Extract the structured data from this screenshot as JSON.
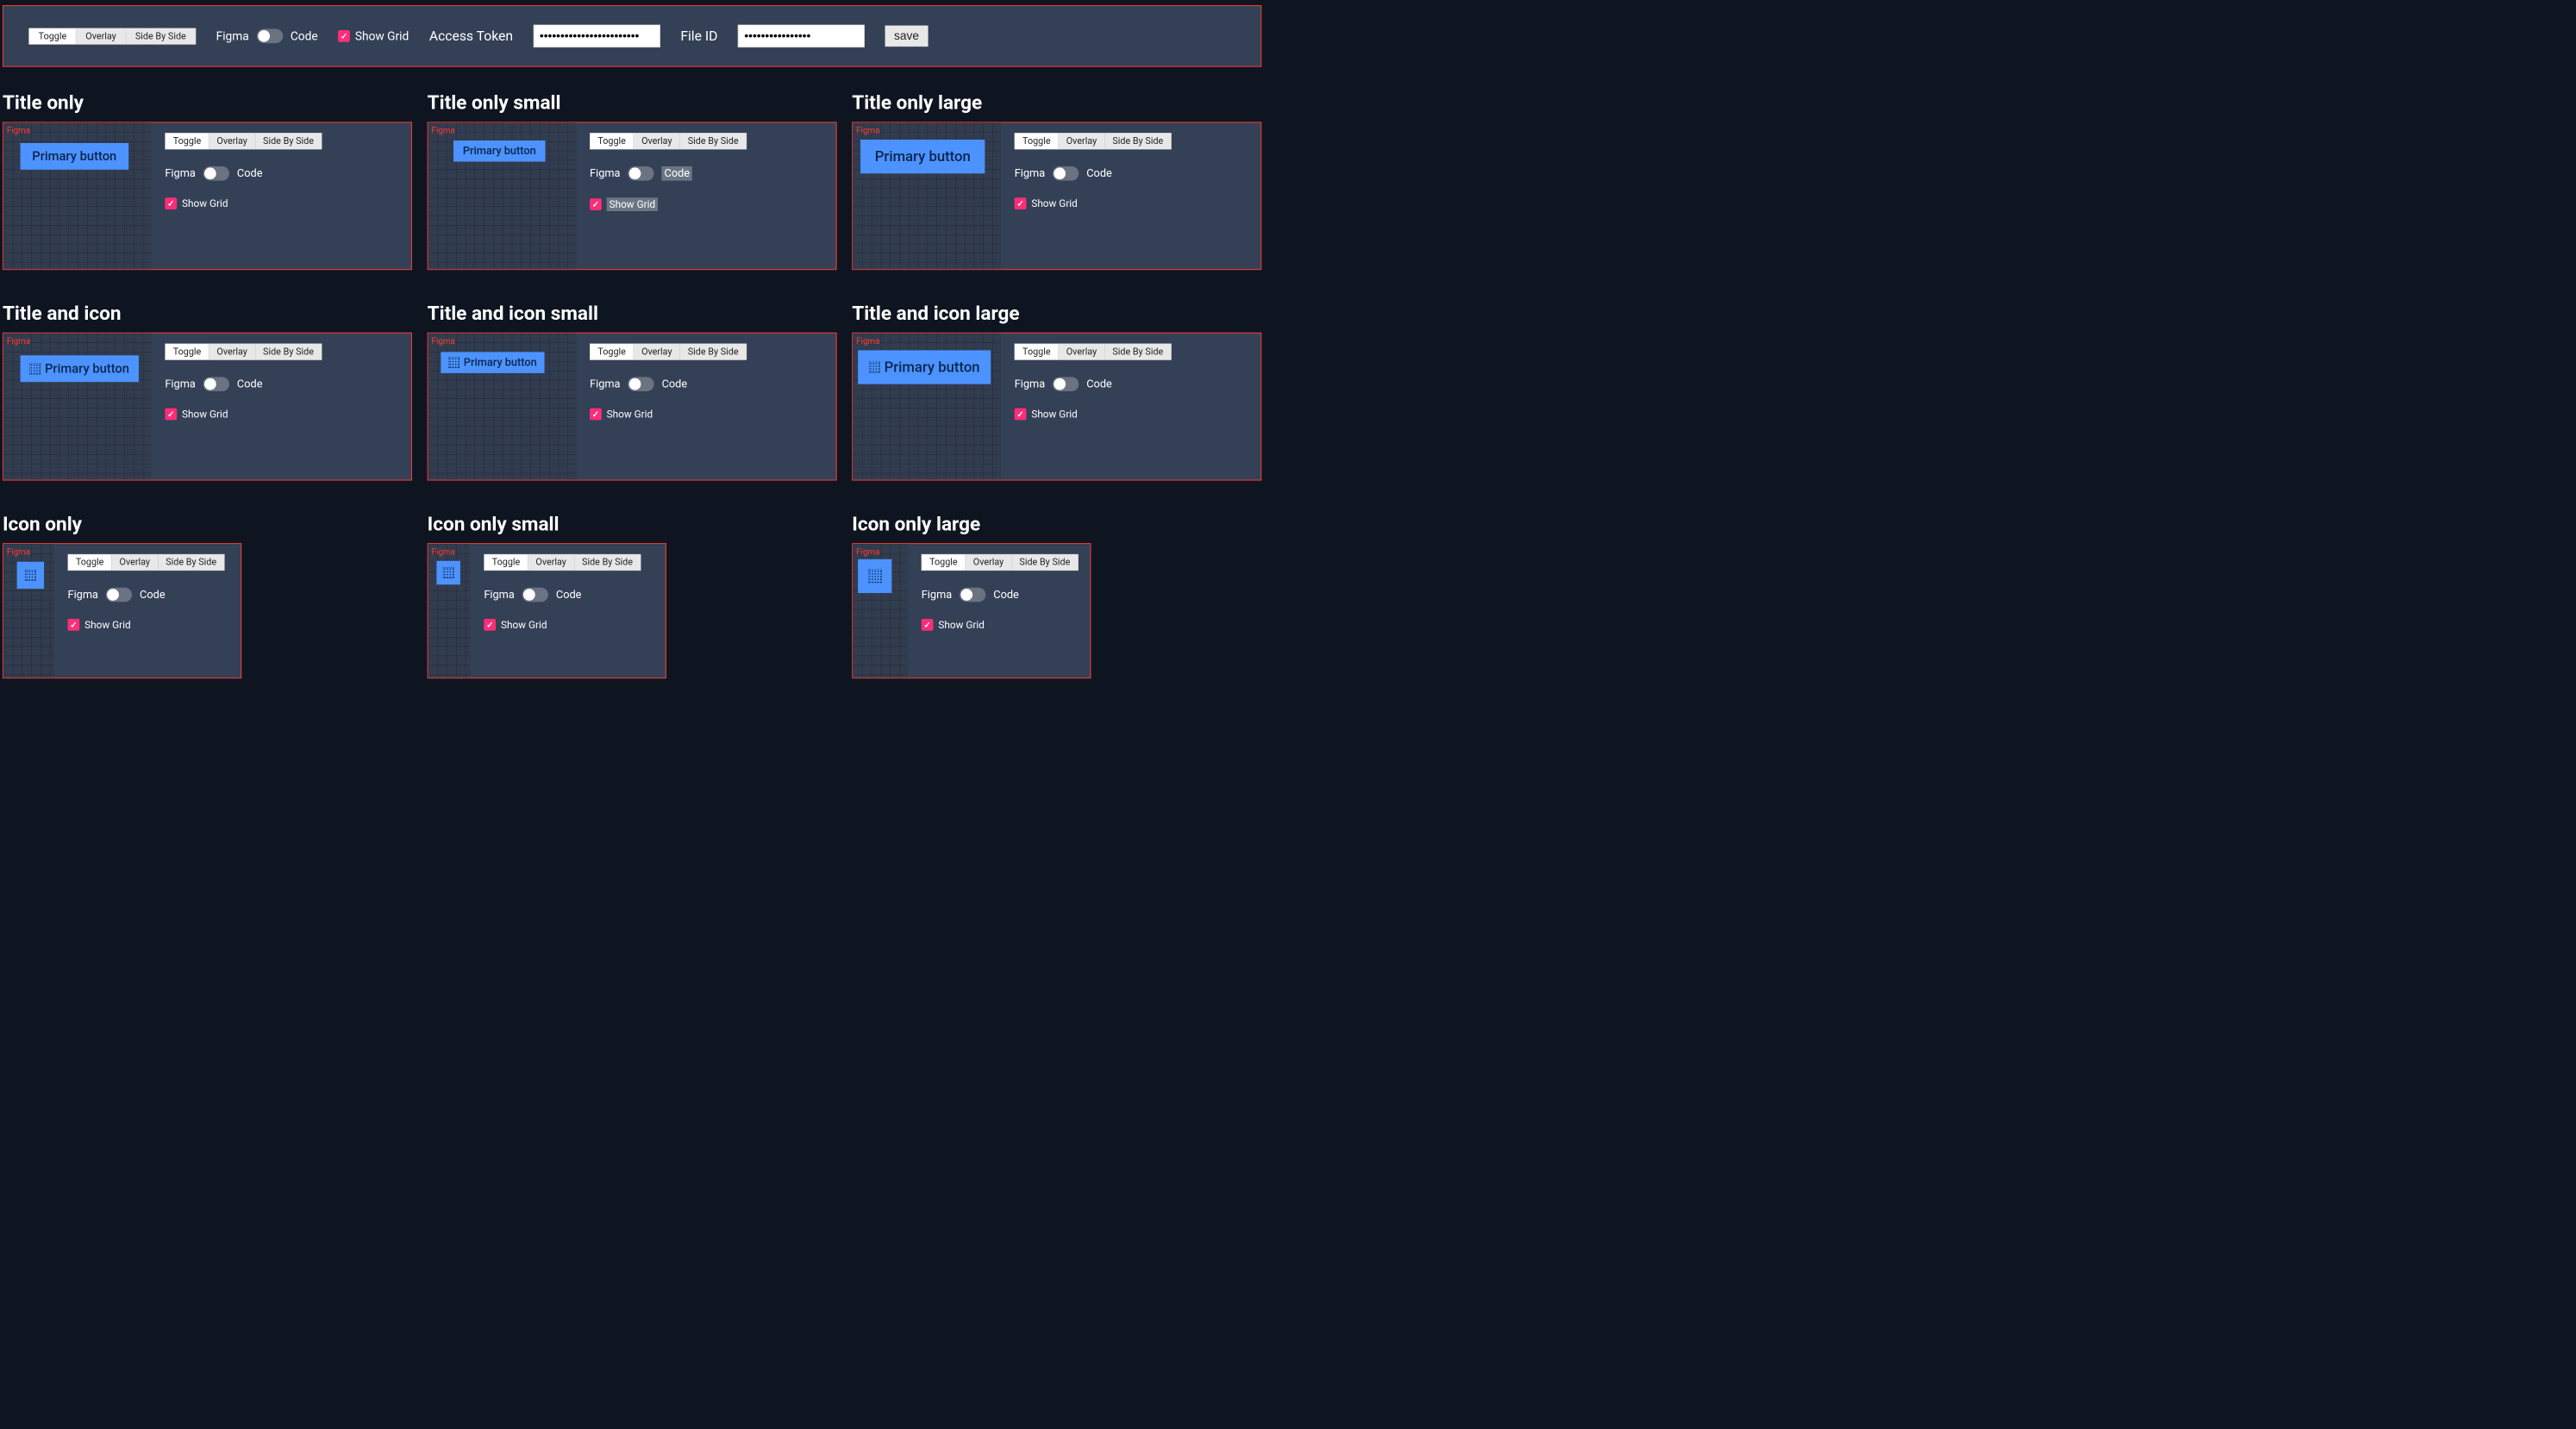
{
  "seg": {
    "toggle": "Toggle",
    "overlay": "Overlay",
    "sbs": "Side By Side"
  },
  "switch": {
    "left": "Figma",
    "right": "Code"
  },
  "grid_label": "Show Grid",
  "top": {
    "access_token_label": "Access Token",
    "file_id_label": "File ID",
    "save": "save"
  },
  "figma_tag": "Figma",
  "primary_button_label": "Primary button",
  "titles": {
    "t0": "Title only",
    "t1": "Title only small",
    "t2": "Title only large",
    "t3": "Title and icon",
    "t4": "Title and icon small",
    "t5": "Title and icon large",
    "t6": "Icon only",
    "t7": "Icon only small",
    "t8": "Icon only large"
  }
}
